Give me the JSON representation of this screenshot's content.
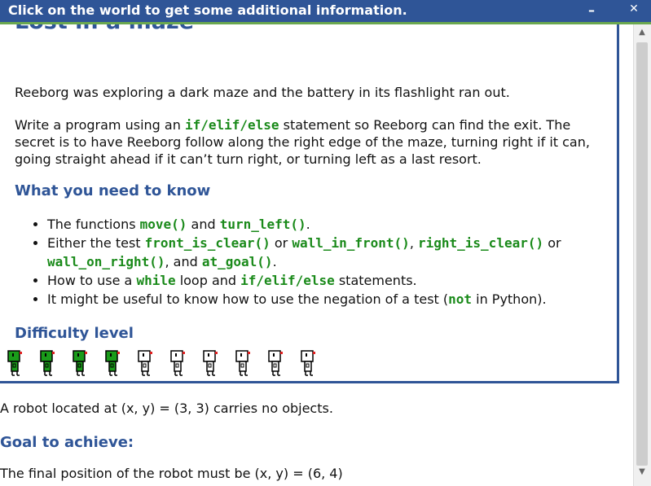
{
  "titlebar": {
    "title": "Click on the world to get some additional information.",
    "minimize": "–",
    "close": "✕"
  },
  "panel": {
    "heading": "Lost in a maze",
    "intro": "Reeborg was exploring a dark maze and the battery in its flashlight ran out.",
    "task": {
      "before": "Write a program using an ",
      "code": "if/elif/else",
      "after_line1": " statement so Reeborg can find the exit. The",
      "line2": "secret is to have Reeborg follow along the right edge of the maze, turning right if it can,",
      "line3": "going straight ahead if it can’t turn right, or turning left as a last resort."
    },
    "know_heading": "What you need to know",
    "know_items": {
      "i1": {
        "t1": "The functions ",
        "c1": "move()",
        "t2": " and ",
        "c2": "turn_left()",
        "t3": "."
      },
      "i2": {
        "t1": "Either the test ",
        "c1": "front_is_clear()",
        "t2": " or ",
        "c2": "wall_in_front()",
        "t3": ", ",
        "c3": "right_is_clear()",
        "t4": " or",
        "c4": "wall_on_right()",
        "t5": ", and ",
        "c5": "at_goal()",
        "t6": "."
      },
      "i3": {
        "t1": "How to use a ",
        "c1": "while",
        "t2": " loop and ",
        "c2": "if/elif/else",
        "t3": " statements."
      },
      "i4": {
        "t1": "It might be useful to know how to use the negation of a test (",
        "c1": "not",
        "t2": " in Python)."
      }
    },
    "difficulty_heading": "Difficulty level",
    "difficulty": {
      "level": 4,
      "max": 10,
      "filled_color": "#1a9c1a",
      "empty_color": "#ffffff"
    }
  },
  "below": {
    "robot_info": "A robot located at (x, y) = (3, 3) carries no objects.",
    "goal_heading": "Goal to achieve:",
    "goal_text": "The final position of the robot must be (x, y) = (6, 4)"
  },
  "scrollbar": {
    "up": "▲",
    "down": "▼"
  }
}
